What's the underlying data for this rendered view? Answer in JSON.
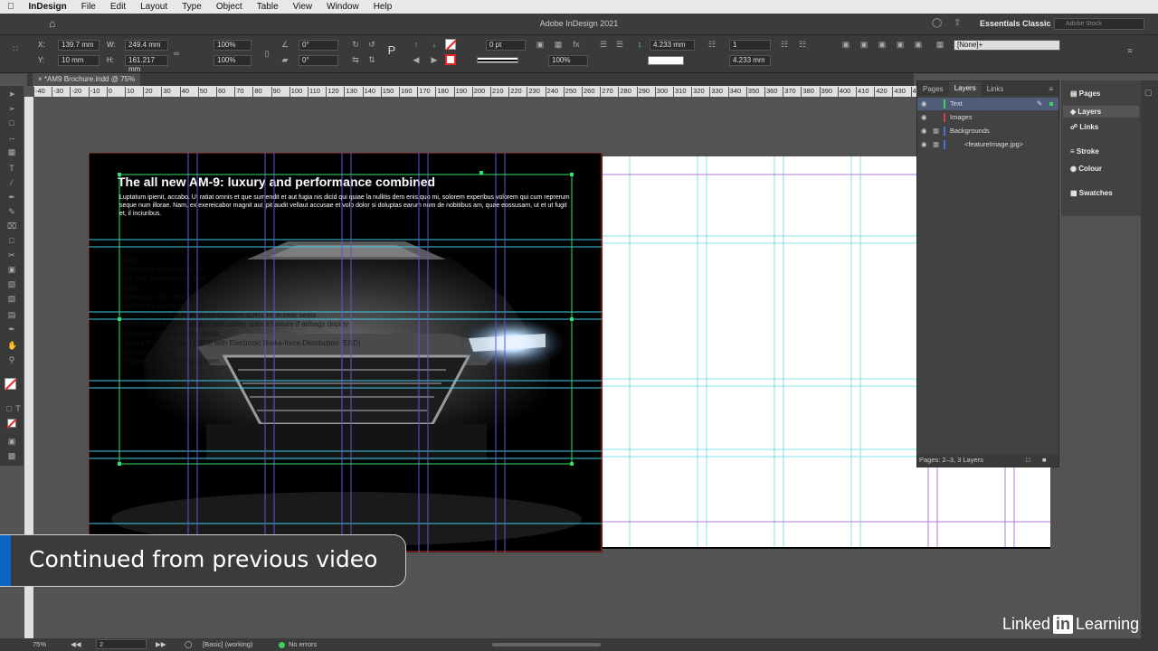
{
  "menubar": {
    "apple_icon": "apple-logo",
    "app": "InDesign",
    "items": [
      "File",
      "Edit",
      "Layout",
      "Type",
      "Object",
      "Table",
      "View",
      "Window",
      "Help"
    ]
  },
  "titlebar": {
    "title": "Adobe InDesign 2021",
    "workspace": "Essentials Classic",
    "search_placeholder": "Adobe Stock"
  },
  "control": {
    "x_label": "X:",
    "x_value": "139.7 mm",
    "y_label": "Y:",
    "y_value": "10 mm",
    "w_label": "W:",
    "w_value": "249.4 mm",
    "h_label": "H:",
    "h_value": "161.217 mm",
    "scale_x": "100%",
    "scale_y": "100%",
    "rotate": "0°",
    "shear": "0°",
    "stroke_weight": "0 pt",
    "opacity": "100%",
    "col_width": "4.233 mm",
    "cols": "1",
    "gutter": "4.233 mm",
    "style": "[None]+"
  },
  "document": {
    "tab_label": "*AM9 Brochure.indd @ 75%"
  },
  "ruler": {
    "ticks": [
      "-40",
      "-30",
      "-20",
      "-10",
      "0",
      "10",
      "20",
      "30",
      "40",
      "50",
      "60",
      "70",
      "80",
      "90",
      "100",
      "110",
      "120",
      "130",
      "140",
      "150",
      "160",
      "170",
      "180",
      "190",
      "200",
      "210",
      "220",
      "230",
      "240",
      "250",
      "260",
      "270",
      "280",
      "290",
      "300",
      "310",
      "320",
      "330",
      "340",
      "350",
      "360",
      "370",
      "380",
      "390",
      "400",
      "410",
      "420",
      "430",
      "440"
    ]
  },
  "page": {
    "headline": "The all new AM-9: luxury and performance combined",
    "body": "Luptatum ipienit, accabo. Ut ratiat omnis et que sumendit et aut fugia nis dicid qui quiae la nullitis dem enis quo mi, solorem experibus volorem qui cum reprerum seque num illorae. Nam, ex exereicabor magnit aut ipit audit vellaut accusae et volo dolor si doluptas earum num de nobitibus am, quae eossusam, ut et ut fugit et, il inciuribus.",
    "bullets": [
      "ndary",
      "ers wipers and headlights",
      "",
      "aint and two-ton pearl pain",
      "ystem",
      "d detection for airbags",
      "and front passenger",
      "ower Anchors and Tethers for Children (LATCH) in rear seats",
      "ower central locking system with safety unlock feature if airbags deploy",
      "econdary collision brake assist",
      "nti-lock Brake System (ABS) with Electronic Brake-force Distribution (EBD)",
      "ear view camera",
      "re-pressure monitoring system"
    ]
  },
  "layers_panel": {
    "tabs": [
      "Pages",
      "Layers",
      "Links"
    ],
    "active_tab": "Layers",
    "layers": [
      {
        "name": "Text",
        "color": "#3cd35a",
        "selected": true
      },
      {
        "name": "Images",
        "color": "#e03a3a",
        "selected": false
      },
      {
        "name": "Backgrounds",
        "color": "#4a6fe0",
        "selected": false
      },
      {
        "name": "<featureImage.jpg>",
        "color": "#4a6fe0",
        "selected": false
      }
    ],
    "footer": "Pages: 2–3, 3 Layers"
  },
  "dock": {
    "items": [
      "Pages",
      "Layers",
      "Links",
      "Stroke",
      "Colour",
      "Swatches"
    ]
  },
  "status": {
    "zoom": "75%",
    "page": "2",
    "mode": "[Basic] (working)",
    "errors": "No errors"
  },
  "overlay": {
    "banner": "Continued from previous video",
    "brand_a": "Linked",
    "brand_box": "in",
    "brand_b": "Learning"
  }
}
